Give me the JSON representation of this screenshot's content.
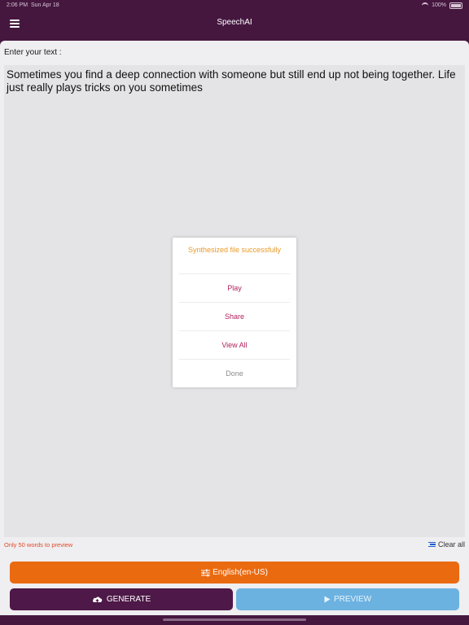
{
  "status_bar": {
    "time": "2:06 PM",
    "date": "Sun Apr 18",
    "battery": "100%"
  },
  "app": {
    "title": "SpeechAI"
  },
  "editor": {
    "label": "Enter your text :",
    "text": "Sometimes you find a deep connection with someone but still end up not being together. Life just really plays tricks on you sometimes",
    "preview_limit_note": "Only 50 words to preview",
    "clear_all_label": "Clear all"
  },
  "controls": {
    "language_label": "English(en-US)",
    "generate_label": "GENERATE",
    "preview_label": "PREVIEW"
  },
  "dialog": {
    "message": "Synthesized file successfully",
    "options": [
      "Play",
      "Share",
      "View All",
      "Done"
    ]
  },
  "colors": {
    "header_bg": "#45173f",
    "language_button": "#ea6a10",
    "generate_button": "#4e1848",
    "preview_button": "#6cb2e1",
    "dialog_message": "#e99a28",
    "dialog_option": "#b1225c",
    "warning_text": "#e24a2c"
  },
  "icons": {
    "menu": "hamburger-icon",
    "language": "sliders-icon",
    "generate": "cloud-upload-icon",
    "preview": "play-icon",
    "clear": "lines-icon"
  }
}
